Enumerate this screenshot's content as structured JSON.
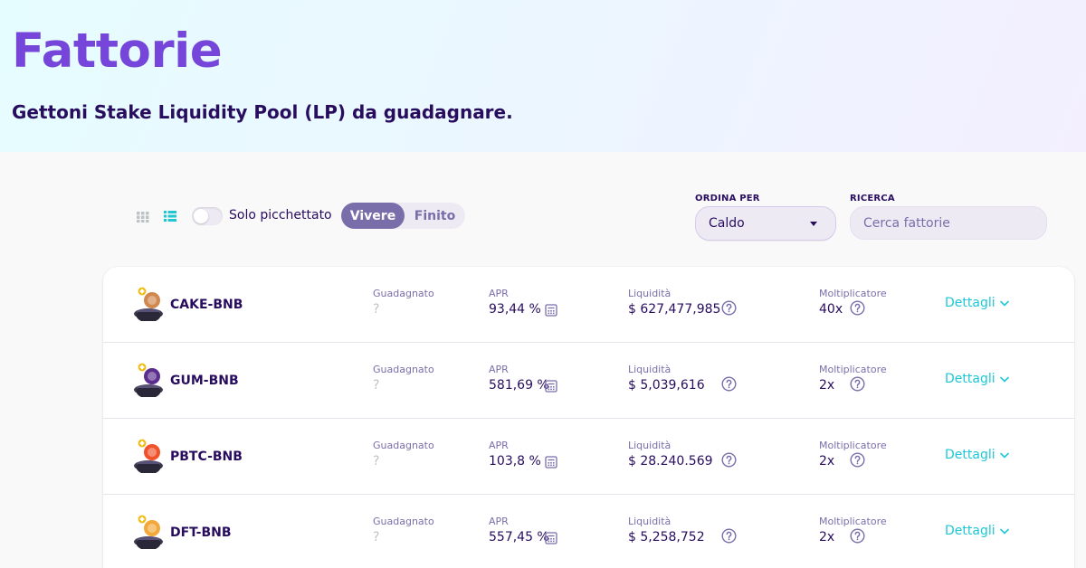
{
  "header": {
    "title": "Fattorie",
    "subtitle": "Gettoni Stake Liquidity Pool (LP) da guadagnare."
  },
  "controls": {
    "staked_only_label": "Solo picchettato",
    "tabs": [
      "Vivere",
      "Finito"
    ],
    "active_tab": "Vivere",
    "sort_label": "ORDINA PER",
    "sort_value": "Caldo",
    "search_label": "RICERCA",
    "search_placeholder": "Cerca fattorie"
  },
  "colors": {
    "brand_purple": "#7645d9",
    "text_dark": "#280d5f",
    "secondary": "#7a6eaa",
    "accent_cyan": "#1fc7d4"
  },
  "farms": [
    {
      "pair": "CAKE-BNB",
      "earned_label": "Guadagnato",
      "earned": "?",
      "apr_label": "APR",
      "apr": "93,44 %",
      "liquidity_label": "Liquidità",
      "liquidity": "$ 627,477,985",
      "multiplier_label": "Moltiplicatore",
      "multiplier": "40x",
      "details": "Dettagli",
      "token_color": "#d1884f"
    },
    {
      "pair": "GUM-BNB",
      "earned_label": "Guadagnato",
      "earned": "?",
      "apr_label": "APR",
      "apr": "581,69 %",
      "liquidity_label": "Liquidità",
      "liquidity": "$ 5,039,616",
      "multiplier_label": "Moltiplicatore",
      "multiplier": "2x",
      "details": "Dettagli",
      "token_color": "#5b2d8e"
    },
    {
      "pair": "PBTC-BNB",
      "earned_label": "Guadagnato",
      "earned": "?",
      "apr_label": "APR",
      "apr": "103,8 %",
      "liquidity_label": "Liquidità",
      "liquidity": "$ 28.240.569",
      "multiplier_label": "Moltiplicatore",
      "multiplier": "2x",
      "details": "Dettagli",
      "token_color": "#f0522b"
    },
    {
      "pair": "DFT-BNB",
      "earned_label": "Guadagnato",
      "earned": "?",
      "apr_label": "APR",
      "apr": "557,45 %",
      "liquidity_label": "Liquidità",
      "liquidity": "$ 5,258,752",
      "multiplier_label": "Moltiplicatore",
      "multiplier": "2x",
      "details": "Dettagli",
      "token_color": "#f3a83b"
    }
  ]
}
